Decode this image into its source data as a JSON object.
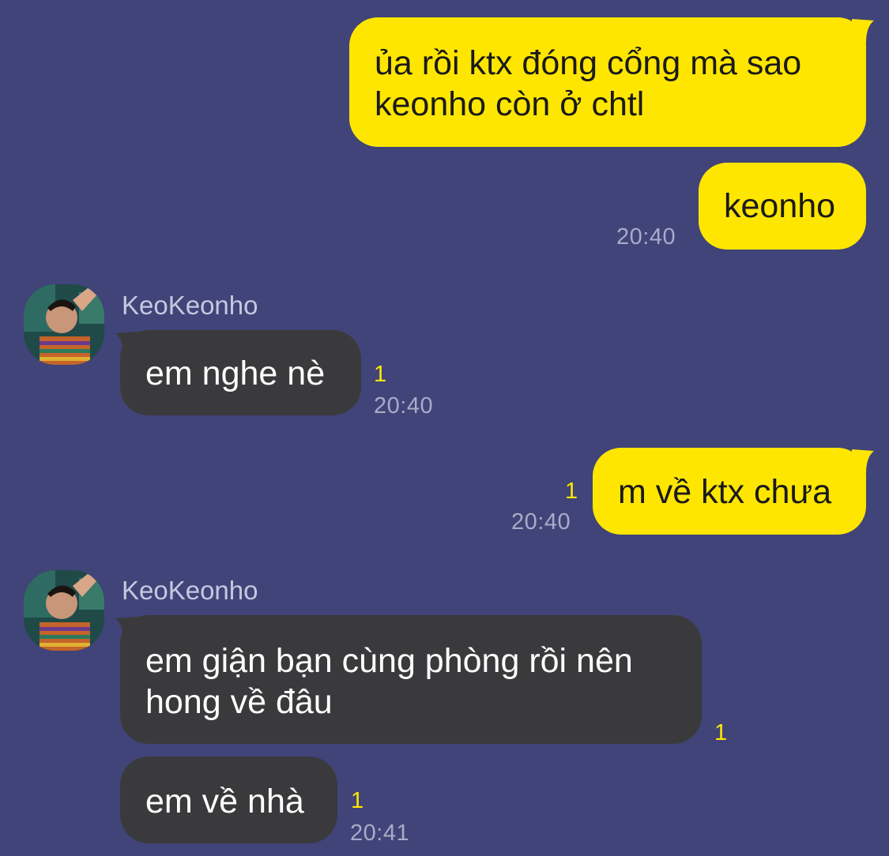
{
  "chat": {
    "colors": {
      "background": "#404478",
      "outgoing_bubble": "#ffe600",
      "incoming_bubble": "#3a3a3c",
      "read_count": "#ffe600",
      "timestamp": "#a9abc9"
    },
    "contact_name": "KeoKeonho",
    "messages": [
      {
        "dir": "out",
        "text": "ủa rồi ktx đóng cổng mà sao keonho còn ở chtl"
      },
      {
        "dir": "out",
        "text": "keonho",
        "time": "20:40"
      },
      {
        "dir": "in",
        "sender": "KeoKeonho",
        "text": "em nghe nè",
        "read": "1",
        "time": "20:40"
      },
      {
        "dir": "out",
        "text": "m về ktx chưa",
        "read": "1",
        "time": "20:40"
      },
      {
        "dir": "in",
        "sender": "KeoKeonho",
        "text": "em giận bạn cùng phòng rồi nên hong về đâu",
        "read": "1"
      },
      {
        "dir": "in",
        "text": "em về nhà",
        "read": "1",
        "time": "20:41"
      }
    ]
  }
}
